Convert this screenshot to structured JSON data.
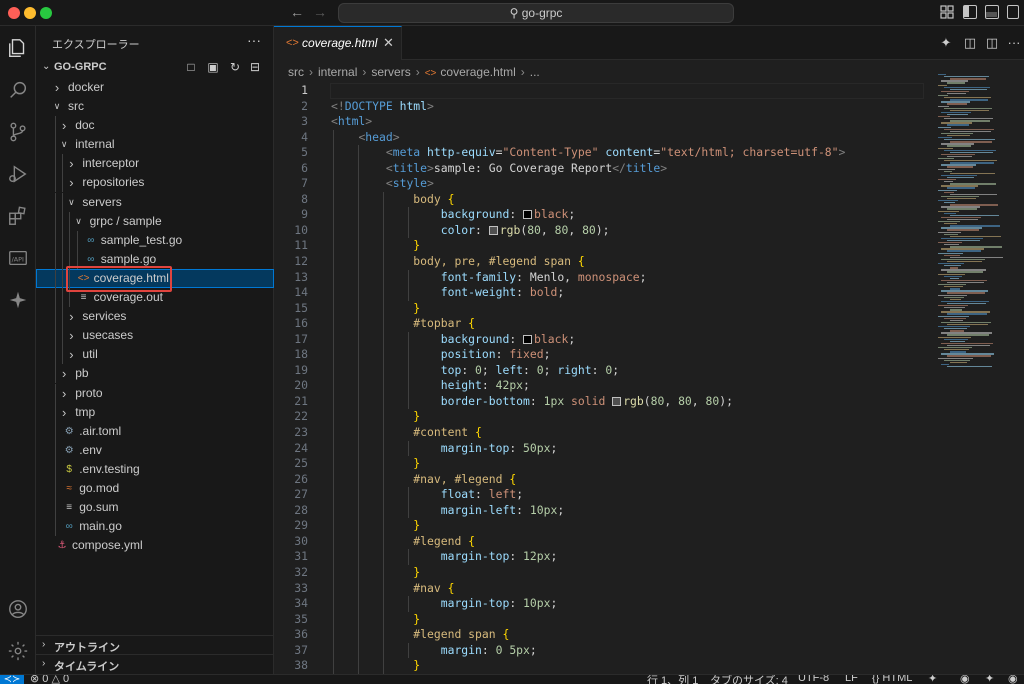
{
  "window": {
    "search_text": "go-grpc"
  },
  "explorer": {
    "title": "エクスプローラー",
    "root_label": "GO-GRPC",
    "tree": [
      {
        "label": "docker",
        "depth": 0,
        "kind": "folder",
        "open": false
      },
      {
        "label": "src",
        "depth": 0,
        "kind": "folder",
        "open": true
      },
      {
        "label": "doc",
        "depth": 1,
        "kind": "folder",
        "open": false
      },
      {
        "label": "internal",
        "depth": 1,
        "kind": "folder",
        "open": true
      },
      {
        "label": "interceptor",
        "depth": 2,
        "kind": "folder",
        "open": false
      },
      {
        "label": "repositories",
        "depth": 2,
        "kind": "folder",
        "open": false
      },
      {
        "label": "servers",
        "depth": 2,
        "kind": "folder",
        "open": true
      },
      {
        "label": "grpc / sample",
        "depth": 3,
        "kind": "folder",
        "open": true
      },
      {
        "label": "sample_test.go",
        "depth": 4,
        "kind": "go"
      },
      {
        "label": "sample.go",
        "depth": 4,
        "kind": "go"
      },
      {
        "label": "coverage.html",
        "depth": 3,
        "kind": "html",
        "selected": true
      },
      {
        "label": "coverage.out",
        "depth": 3,
        "kind": "text"
      },
      {
        "label": "services",
        "depth": 2,
        "kind": "folder",
        "open": false
      },
      {
        "label": "usecases",
        "depth": 2,
        "kind": "folder",
        "open": false
      },
      {
        "label": "util",
        "depth": 2,
        "kind": "folder",
        "open": false
      },
      {
        "label": "pb",
        "depth": 1,
        "kind": "folder",
        "open": false
      },
      {
        "label": "proto",
        "depth": 1,
        "kind": "folder",
        "open": false
      },
      {
        "label": "tmp",
        "depth": 1,
        "kind": "folder",
        "open": false
      },
      {
        "label": ".air.toml",
        "depth": 1,
        "kind": "gear"
      },
      {
        "label": ".env",
        "depth": 1,
        "kind": "gear"
      },
      {
        "label": ".env.testing",
        "depth": 1,
        "kind": "dollar"
      },
      {
        "label": "go.mod",
        "depth": 1,
        "kind": "rss"
      },
      {
        "label": "go.sum",
        "depth": 1,
        "kind": "text"
      },
      {
        "label": "main.go",
        "depth": 1,
        "kind": "go"
      },
      {
        "label": "compose.yml",
        "depth": 0,
        "kind": "docker"
      }
    ],
    "outline_label": "アウトライン",
    "timeline_label": "タイムライン"
  },
  "editor": {
    "tab_label": "coverage.html",
    "breadcrumb": [
      "src",
      "internal",
      "servers",
      "coverage.html",
      "..."
    ],
    "current_line": 1,
    "lines": [
      [],
      [
        [
          "brk",
          "<!"
        ],
        [
          "tag",
          "DOCTYPE"
        ],
        [
          "pl",
          " "
        ],
        [
          "attr",
          "html"
        ],
        [
          "brk",
          ">"
        ]
      ],
      [
        [
          "brk",
          "<"
        ],
        [
          "tag",
          "html"
        ],
        [
          "brk",
          ">"
        ]
      ],
      [
        [
          "pl",
          "    "
        ],
        [
          "brk",
          "<"
        ],
        [
          "tag",
          "head"
        ],
        [
          "brk",
          ">"
        ]
      ],
      [
        [
          "pl",
          "        "
        ],
        [
          "brk",
          "<"
        ],
        [
          "tag",
          "meta"
        ],
        [
          "pl",
          " "
        ],
        [
          "attr",
          "http-equiv"
        ],
        [
          "pl",
          "="
        ],
        [
          "str",
          "\"Content-Type\""
        ],
        [
          "pl",
          " "
        ],
        [
          "attr",
          "content"
        ],
        [
          "pl",
          "="
        ],
        [
          "str",
          "\"text/html; charset=utf-8\""
        ],
        [
          "brk",
          ">"
        ]
      ],
      [
        [
          "pl",
          "        "
        ],
        [
          "brk",
          "<"
        ],
        [
          "tag",
          "title"
        ],
        [
          "brk",
          ">"
        ],
        [
          "pl",
          "sample: Go Coverage Report"
        ],
        [
          "brk",
          "</"
        ],
        [
          "tag",
          "title"
        ],
        [
          "brk",
          ">"
        ]
      ],
      [
        [
          "pl",
          "        "
        ],
        [
          "brk",
          "<"
        ],
        [
          "tag",
          "style"
        ],
        [
          "brk",
          ">"
        ]
      ],
      [
        [
          "pl",
          "            "
        ],
        [
          "sel",
          "body"
        ],
        [
          "pl",
          " "
        ],
        [
          "brace",
          "{"
        ]
      ],
      [
        [
          "pl",
          "                "
        ],
        [
          "prop",
          "background"
        ],
        [
          "pl",
          ": "
        ],
        [
          "sw",
          "#000000"
        ],
        [
          "val",
          "black"
        ],
        [
          "pl",
          ";"
        ]
      ],
      [
        [
          "pl",
          "                "
        ],
        [
          "prop",
          "color"
        ],
        [
          "pl",
          ": "
        ],
        [
          "sw",
          "#505050"
        ],
        [
          "fn",
          "rgb"
        ],
        [
          "pl",
          "("
        ],
        [
          "num",
          "80"
        ],
        [
          "pl",
          ", "
        ],
        [
          "num",
          "80"
        ],
        [
          "pl",
          ", "
        ],
        [
          "num",
          "80"
        ],
        [
          "pl",
          ");"
        ]
      ],
      [
        [
          "pl",
          "            "
        ],
        [
          "brace",
          "}"
        ]
      ],
      [
        [
          "pl",
          "            "
        ],
        [
          "sel",
          "body, pre, #legend span"
        ],
        [
          "pl",
          " "
        ],
        [
          "brace",
          "{"
        ]
      ],
      [
        [
          "pl",
          "                "
        ],
        [
          "prop",
          "font-family"
        ],
        [
          "pl",
          ": Menlo, "
        ],
        [
          "val",
          "monospace"
        ],
        [
          "pl",
          ";"
        ]
      ],
      [
        [
          "pl",
          "                "
        ],
        [
          "prop",
          "font-weight"
        ],
        [
          "pl",
          ": "
        ],
        [
          "val",
          "bold"
        ],
        [
          "pl",
          ";"
        ]
      ],
      [
        [
          "pl",
          "            "
        ],
        [
          "brace",
          "}"
        ]
      ],
      [
        [
          "pl",
          "            "
        ],
        [
          "sel",
          "#topbar"
        ],
        [
          "pl",
          " "
        ],
        [
          "brace",
          "{"
        ]
      ],
      [
        [
          "pl",
          "                "
        ],
        [
          "prop",
          "background"
        ],
        [
          "pl",
          ": "
        ],
        [
          "sw",
          "#000000"
        ],
        [
          "val",
          "black"
        ],
        [
          "pl",
          ";"
        ]
      ],
      [
        [
          "pl",
          "                "
        ],
        [
          "prop",
          "position"
        ],
        [
          "pl",
          ": "
        ],
        [
          "val",
          "fixed"
        ],
        [
          "pl",
          ";"
        ]
      ],
      [
        [
          "pl",
          "                "
        ],
        [
          "prop",
          "top"
        ],
        [
          "pl",
          ": "
        ],
        [
          "num",
          "0"
        ],
        [
          "pl",
          "; "
        ],
        [
          "prop",
          "left"
        ],
        [
          "pl",
          ": "
        ],
        [
          "num",
          "0"
        ],
        [
          "pl",
          "; "
        ],
        [
          "prop",
          "right"
        ],
        [
          "pl",
          ": "
        ],
        [
          "num",
          "0"
        ],
        [
          "pl",
          ";"
        ]
      ],
      [
        [
          "pl",
          "                "
        ],
        [
          "prop",
          "height"
        ],
        [
          "pl",
          ": "
        ],
        [
          "num",
          "42px"
        ],
        [
          "pl",
          ";"
        ]
      ],
      [
        [
          "pl",
          "                "
        ],
        [
          "prop",
          "border-bottom"
        ],
        [
          "pl",
          ": "
        ],
        [
          "num",
          "1px"
        ],
        [
          "pl",
          " "
        ],
        [
          "val",
          "solid"
        ],
        [
          "pl",
          " "
        ],
        [
          "sw",
          "#505050"
        ],
        [
          "fn",
          "rgb"
        ],
        [
          "pl",
          "("
        ],
        [
          "num",
          "80"
        ],
        [
          "pl",
          ", "
        ],
        [
          "num",
          "80"
        ],
        [
          "pl",
          ", "
        ],
        [
          "num",
          "80"
        ],
        [
          "pl",
          ");"
        ]
      ],
      [
        [
          "pl",
          "            "
        ],
        [
          "brace",
          "}"
        ]
      ],
      [
        [
          "pl",
          "            "
        ],
        [
          "sel",
          "#content"
        ],
        [
          "pl",
          " "
        ],
        [
          "brace",
          "{"
        ]
      ],
      [
        [
          "pl",
          "                "
        ],
        [
          "prop",
          "margin-top"
        ],
        [
          "pl",
          ": "
        ],
        [
          "num",
          "50px"
        ],
        [
          "pl",
          ";"
        ]
      ],
      [
        [
          "pl",
          "            "
        ],
        [
          "brace",
          "}"
        ]
      ],
      [
        [
          "pl",
          "            "
        ],
        [
          "sel",
          "#nav, #legend"
        ],
        [
          "pl",
          " "
        ],
        [
          "brace",
          "{"
        ]
      ],
      [
        [
          "pl",
          "                "
        ],
        [
          "prop",
          "float"
        ],
        [
          "pl",
          ": "
        ],
        [
          "val",
          "left"
        ],
        [
          "pl",
          ";"
        ]
      ],
      [
        [
          "pl",
          "                "
        ],
        [
          "prop",
          "margin-left"
        ],
        [
          "pl",
          ": "
        ],
        [
          "num",
          "10px"
        ],
        [
          "pl",
          ";"
        ]
      ],
      [
        [
          "pl",
          "            "
        ],
        [
          "brace",
          "}"
        ]
      ],
      [
        [
          "pl",
          "            "
        ],
        [
          "sel",
          "#legend"
        ],
        [
          "pl",
          " "
        ],
        [
          "brace",
          "{"
        ]
      ],
      [
        [
          "pl",
          "                "
        ],
        [
          "prop",
          "margin-top"
        ],
        [
          "pl",
          ": "
        ],
        [
          "num",
          "12px"
        ],
        [
          "pl",
          ";"
        ]
      ],
      [
        [
          "pl",
          "            "
        ],
        [
          "brace",
          "}"
        ]
      ],
      [
        [
          "pl",
          "            "
        ],
        [
          "sel",
          "#nav"
        ],
        [
          "pl",
          " "
        ],
        [
          "brace",
          "{"
        ]
      ],
      [
        [
          "pl",
          "                "
        ],
        [
          "prop",
          "margin-top"
        ],
        [
          "pl",
          ": "
        ],
        [
          "num",
          "10px"
        ],
        [
          "pl",
          ";"
        ]
      ],
      [
        [
          "pl",
          "            "
        ],
        [
          "brace",
          "}"
        ]
      ],
      [
        [
          "pl",
          "            "
        ],
        [
          "sel",
          "#legend span"
        ],
        [
          "pl",
          " "
        ],
        [
          "brace",
          "{"
        ]
      ],
      [
        [
          "pl",
          "                "
        ],
        [
          "prop",
          "margin"
        ],
        [
          "pl",
          ": "
        ],
        [
          "num",
          "0"
        ],
        [
          "pl",
          " "
        ],
        [
          "num",
          "5px"
        ],
        [
          "pl",
          ";"
        ]
      ],
      [
        [
          "pl",
          "            "
        ],
        [
          "brace",
          "}"
        ]
      ]
    ]
  },
  "status": {
    "errors": "0",
    "warnings": "0",
    "position": "行 1、列 1",
    "indent": "タブのサイズ: 4",
    "encoding": "UTF-8",
    "eol": "LF",
    "language": "HTML"
  },
  "colors": {
    "accent": "#0078d4",
    "highlight_box": "#e0443e",
    "selected_row": "#04395e"
  }
}
